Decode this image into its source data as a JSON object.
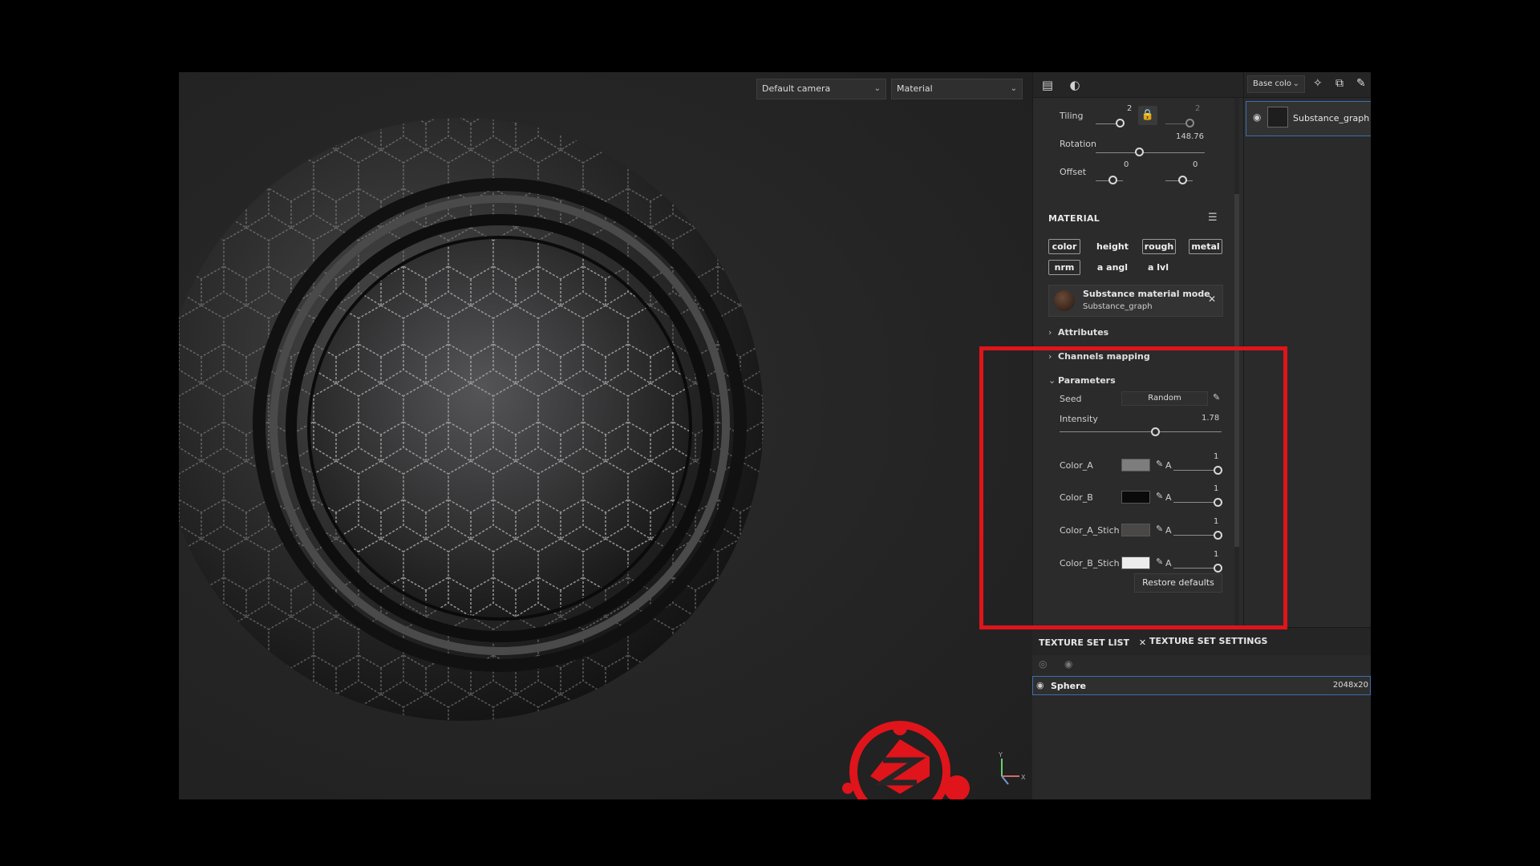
{
  "viewport": {
    "camera_dropdown": "Default camera",
    "mode_dropdown": "Material",
    "axis_labels": {
      "y": "Y",
      "x": "X"
    },
    "logo_color": "#e0141b"
  },
  "properties_tabs": [
    "layer-properties-icon",
    "material-ball-icon"
  ],
  "transform": {
    "tiling_label": "Tiling",
    "tiling_u": "2",
    "tiling_v": "2",
    "rotation_label": "Rotation",
    "rotation_value": "148.76",
    "offset_label": "Offset",
    "offset_u": "0",
    "offset_v": "0"
  },
  "material": {
    "title": "MATERIAL",
    "chips": [
      "color",
      "height",
      "rough",
      "metal",
      "nrm",
      "a angl",
      "a lvl"
    ],
    "substance_title": "Substance material mode",
    "substance_sub": "Substance_graph"
  },
  "sections": {
    "attributes": "Attributes",
    "channels_mapping": "Channels mapping",
    "parameters": "Parameters"
  },
  "parameters": {
    "seed_label": "Seed",
    "seed_value": "Random",
    "intensity_label": "Intensity",
    "intensity_value": "1.78",
    "intensity_fraction": 0.59,
    "colors": [
      {
        "label": "Color_A",
        "swatch": "#7d7d7d",
        "alpha_label": "A",
        "alpha_value": "1"
      },
      {
        "label": "Color_B",
        "swatch": "#0a0a0a",
        "alpha_label": "A",
        "alpha_value": "1"
      },
      {
        "label": "Color_A_Stich",
        "swatch": "#4a4846",
        "alpha_label": "A",
        "alpha_value": "1"
      },
      {
        "label": "Color_B_Stich",
        "swatch": "#ececec",
        "alpha_label": "A",
        "alpha_value": "1"
      }
    ],
    "restore_button": "Restore defaults"
  },
  "layers": {
    "channel_dropdown": "Base colo",
    "layer_name": "Substance_graph"
  },
  "texture_sets": {
    "tab_list": "TEXTURE SET LIST",
    "tab_settings": "TEXTURE SET SETTINGS",
    "row_name": "Sphere",
    "row_resolution": "2048x20"
  },
  "colors": {
    "highlight": "#e0141b",
    "selection": "#3d6fae"
  }
}
